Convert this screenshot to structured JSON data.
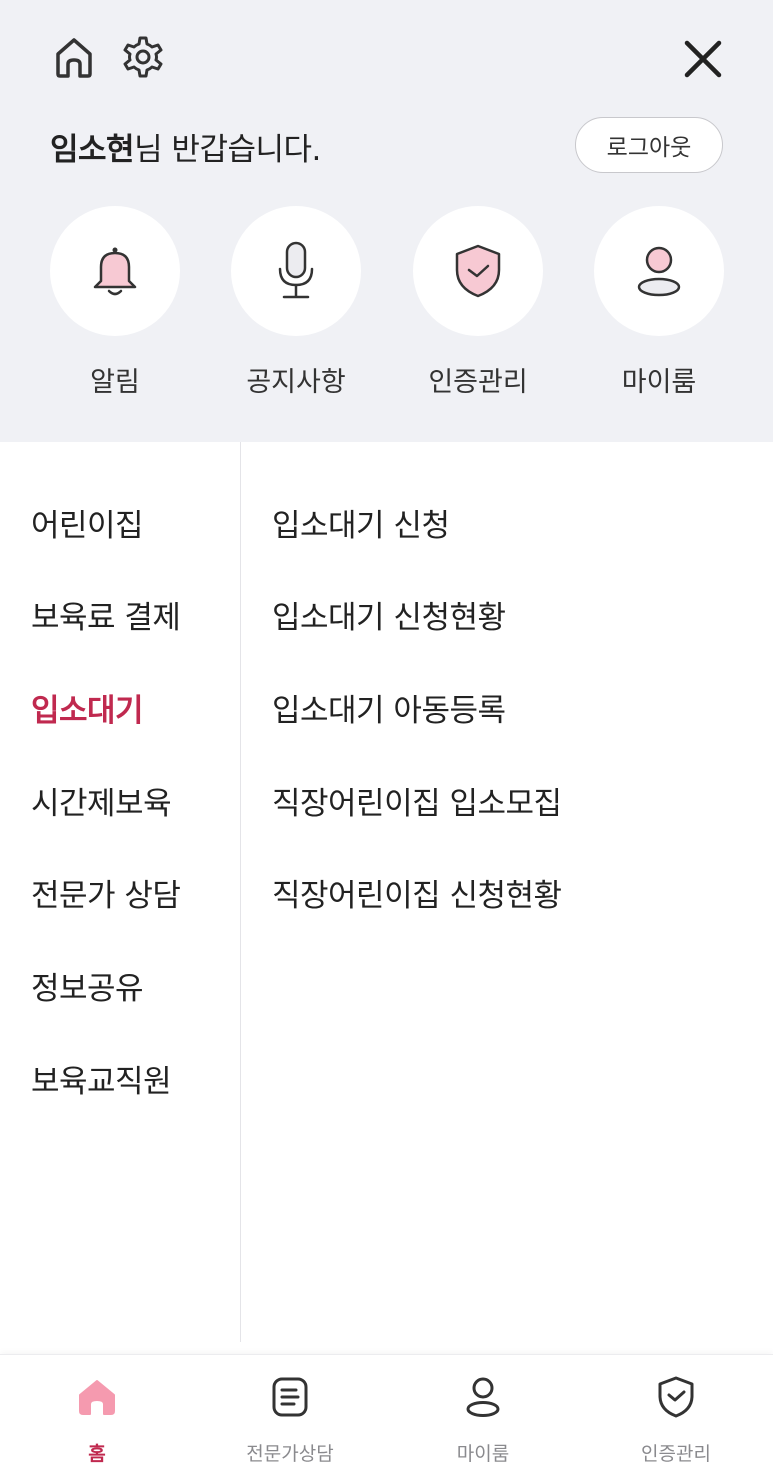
{
  "header": {
    "user_name": "임소현",
    "greeting_suffix": "님 반갑습니다.",
    "logout_label": "로그아웃"
  },
  "quick_menu": [
    {
      "label": "알림",
      "icon": "bell-icon"
    },
    {
      "label": "공지사항",
      "icon": "microphone-icon"
    },
    {
      "label": "인증관리",
      "icon": "shield-check-icon"
    },
    {
      "label": "마이룸",
      "icon": "user-icon"
    }
  ],
  "left_menu": [
    {
      "label": "어린이집",
      "active": false
    },
    {
      "label": "보육료 결제",
      "active": false
    },
    {
      "label": "입소대기",
      "active": true
    },
    {
      "label": "시간제보육",
      "active": false
    },
    {
      "label": "전문가 상담",
      "active": false
    },
    {
      "label": "정보공유",
      "active": false
    },
    {
      "label": "보육교직원",
      "active": false
    }
  ],
  "right_menu": [
    {
      "label": "입소대기 신청"
    },
    {
      "label": "입소대기 신청현황"
    },
    {
      "label": "입소대기 아동등록"
    },
    {
      "label": "직장어린이집 입소모집"
    },
    {
      "label": "직장어린이집 신청현황"
    }
  ],
  "bottom_tabs": [
    {
      "label": "홈",
      "icon": "home-icon",
      "active": true
    },
    {
      "label": "전문가상담",
      "icon": "document-icon",
      "active": false
    },
    {
      "label": "마이룸",
      "icon": "user-icon",
      "active": false
    },
    {
      "label": "인증관리",
      "icon": "shield-check-icon",
      "active": false
    }
  ],
  "colors": {
    "accent": "#c0294f",
    "accent_soft": "#f5c4cf",
    "header_bg": "#f0f1f5",
    "icon_stroke": "#333333"
  }
}
